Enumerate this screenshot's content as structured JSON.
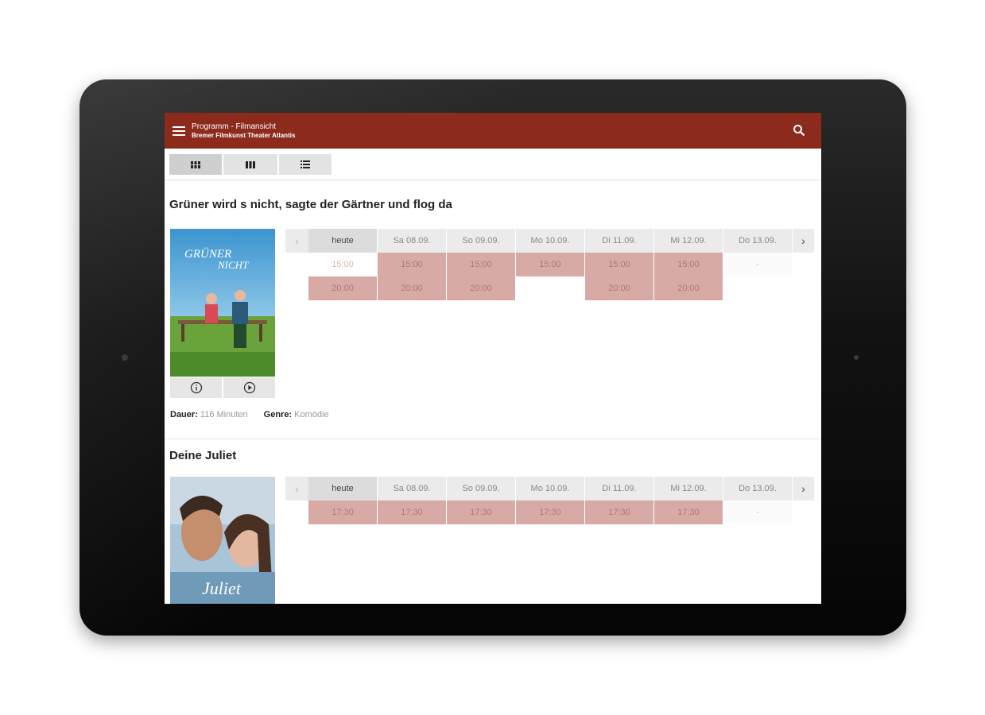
{
  "app": {
    "title": "Programm - Filmansicht",
    "subtitle": "Bremer Filmkunst Theater Atlantis",
    "accent": "#8c2a1c"
  },
  "views": [
    "grid-view-icon",
    "columns-view-icon",
    "list-view-icon"
  ],
  "labels": {
    "duration": "Dauer:",
    "genre": "Genre:"
  },
  "days": [
    "heute",
    "Sa 08.09.",
    "So 09.09.",
    "Mo 10.09.",
    "Di 11.09.",
    "Mi 12.09.",
    "Do 13.09."
  ],
  "films": [
    {
      "title": "Grüner wird s nicht, sagte der Gärtner und flog da",
      "poster_text": "GRÜNER WIRD'S NICHT",
      "duration": "116 Minuten",
      "genre": "Komödie",
      "showtimes": [
        [
          "15:00",
          "15:00",
          "15:00",
          "15:00",
          "15:00",
          "15:00",
          "-"
        ],
        [
          "20:00",
          "20:00",
          "20:00",
          "",
          "20:00",
          "20:00",
          ""
        ]
      ]
    },
    {
      "title": "Deine Juliet",
      "poster_text": "Juliet",
      "showtimes": [
        [
          "17:30",
          "17:30",
          "17:30",
          "17:30",
          "17:30",
          "17:30",
          "-"
        ]
      ]
    }
  ],
  "nav": {
    "prev": "‹",
    "next": "›"
  }
}
